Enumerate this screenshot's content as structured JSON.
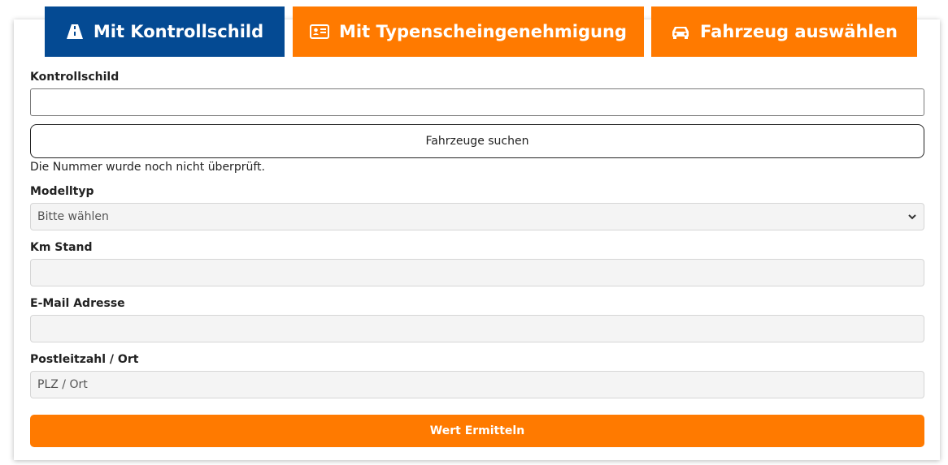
{
  "tabs": [
    {
      "label": "Mit Kontrollschild",
      "icon": "road-icon",
      "active": true,
      "color": "#044a93"
    },
    {
      "label": "Mit Typenscheingenehmigung",
      "icon": "id-card-icon",
      "active": false,
      "color": "#ff7a00"
    },
    {
      "label": "Fahrzeug auswählen",
      "icon": "car-icon",
      "active": false,
      "color": "#ff7a00"
    }
  ],
  "form": {
    "plate": {
      "label": "Kontrollschild",
      "value": ""
    },
    "search_button": "Fahrzeuge suchen",
    "status_note": "Die Nummer wurde noch nicht überprüft.",
    "model": {
      "label": "Modelltyp",
      "selected": "Bitte wählen"
    },
    "km": {
      "label": "Km Stand",
      "value": ""
    },
    "email": {
      "label": "E-Mail Adresse",
      "value": ""
    },
    "zip": {
      "label": "Postleitzahl / Ort",
      "placeholder": "PLZ / Ort"
    },
    "submit_button": "Wert Ermitteln"
  },
  "colors": {
    "accent": "#ff7a00",
    "primary": "#044a93"
  }
}
